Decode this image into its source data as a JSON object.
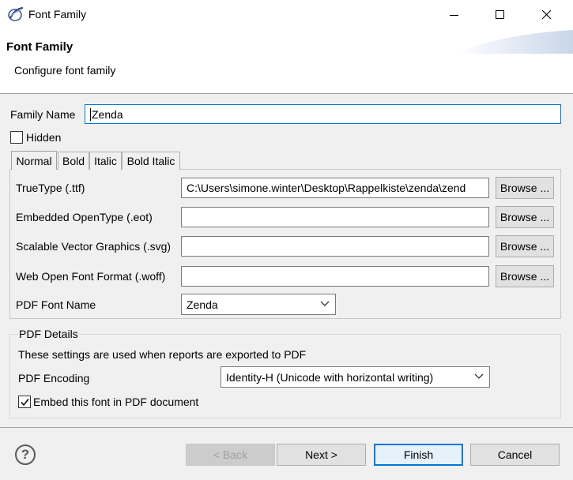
{
  "window": {
    "title": "Font Family",
    "icon": "eclipse-app-icon"
  },
  "header": {
    "title": "Font Family",
    "description": "Configure font family"
  },
  "form": {
    "family_name_label": "Family Name",
    "family_name_value": "Zenda",
    "hidden_label": "Hidden",
    "hidden_checked": false
  },
  "tabs": [
    {
      "label": "Normal",
      "active": true
    },
    {
      "label": "Bold",
      "active": false
    },
    {
      "label": "Italic",
      "active": false
    },
    {
      "label": "Bold Italic",
      "active": false
    }
  ],
  "font_files": {
    "truetype_label": "TrueType (.ttf)",
    "truetype_value": "C:\\Users\\simone.winter\\Desktop\\Rappelkiste\\zenda\\zend",
    "eot_label": "Embedded OpenType (.eot)",
    "eot_value": "",
    "svg_label": "Scalable Vector Graphics (.svg)",
    "svg_value": "",
    "woff_label": "Web Open Font Format (.woff)",
    "woff_value": "",
    "browse_label": "Browse ...",
    "pdf_font_name_label": "PDF Font Name",
    "pdf_font_name_value": "Zenda"
  },
  "pdf_details": {
    "group_title": "PDF Details",
    "info": "These settings are used when reports are exported to PDF",
    "encoding_label": "PDF Encoding",
    "encoding_value": "Identity-H (Unicode with horizontal writing)",
    "embed_label": "Embed this font in PDF document",
    "embed_checked": true
  },
  "footer": {
    "help_symbol": "?",
    "back_label": "< Back",
    "next_label": "Next >",
    "finish_label": "Finish",
    "cancel_label": "Cancel"
  },
  "colors": {
    "accent": "#0078d7",
    "body_bg": "#f0f0f0"
  }
}
